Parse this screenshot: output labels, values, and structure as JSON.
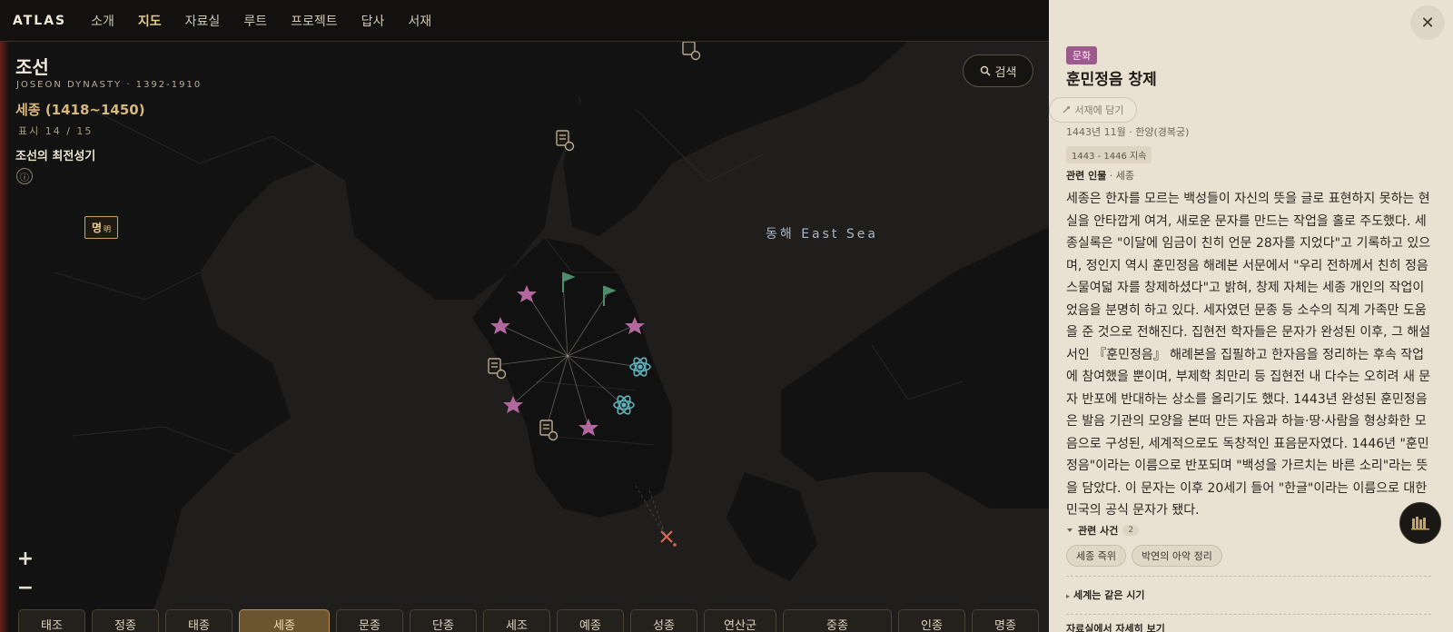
{
  "nav": {
    "brand": "ATLAS",
    "items": [
      "소개",
      "지도",
      "자료실",
      "루트",
      "프로젝트",
      "답사",
      "서재"
    ],
    "active_index": 1
  },
  "era": {
    "title": "조선",
    "subtitle": "JOSEON DYNASTY · 1392-1910",
    "reign": "세종 (1418~1450)",
    "count": "표시 14 / 15",
    "motto": "조선의 최전성기",
    "info_symbol": "ⓘ"
  },
  "map": {
    "ming_label": "명",
    "ming_hanja": "明",
    "sea_label": "동해 East Sea",
    "search_label": "검색",
    "zoom_in": "+",
    "zoom_out": "−"
  },
  "timeline": {
    "items": [
      "태조",
      "정종",
      "태종",
      "세종",
      "문종",
      "단종",
      "세조",
      "예종",
      "성종",
      "연산군",
      "중종",
      "인종",
      "명종"
    ],
    "active_index": 3
  },
  "panel": {
    "category": "문화",
    "title": "훈민정음 창제",
    "save_label": "서재에 담기",
    "date": "1443년 11월 · 한양(경복궁)",
    "duration": "1443 - 1446 지속",
    "related_person_label": "관련 인물",
    "related_person": " · 세종",
    "body": "세종은 한자를 모르는 백성들이 자신의 뜻을 글로 표현하지 못하는 현실을 안타깝게 여겨, 새로운 문자를 만드는 작업을 홀로 주도했다. 세종실록은 \"이달에 임금이 친히 언문 28자를 지었다\"고 기록하고 있으며, 정인지 역시 훈민정음 해례본 서문에서 \"우리 전하께서 친히 정음 스물여덟 자를 창제하셨다\"고 밝혀, 창제 자체는 세종 개인의 작업이었음을 분명히 하고 있다. 세자였던 문종 등 소수의 직계 가족만 도움을 준 것으로 전해진다. 집현전 학자들은 문자가 완성된 이후, 그 해설서인 『훈민정음』 해례본을 집필하고 한자음을 정리하는 후속 작업에 참여했을 뿐이며, 부제학 최만리 등 집현전 내 다수는 오히려 새 문자 반포에 반대하는 상소를 올리기도 했다. 1443년 완성된 훈민정음은 발음 기관의 모양을 본떠 만든 자음과 하늘·땅·사람을 형상화한 모음으로 구성된, 세계적으로도 독창적인 표음문자였다. 1446년 \"훈민정음\"이라는 이름으로 반포되며 \"백성을 가르치는 바른 소리\"라는 뜻을 담았다. 이 문자는 이후 20세기 들어 \"한글\"이라는 이름으로 대한민국의 공식 문자가 됐다.",
    "events_label": "관련 사건",
    "events_count": "2",
    "events": [
      "세종 즉위",
      "박연의 아악 정리"
    ],
    "world_label": "세계는 같은 시기",
    "archive_label": "자료실에서 자세히 보기",
    "close_symbol": "✕"
  },
  "colors": {
    "accent_gold": "#d7b77a",
    "culture_purple": "#9c5a8f",
    "star_pink": "#b2679e",
    "atom_teal": "#5fb4bd",
    "flag_green": "#4f8c6c",
    "panel_bg": "#e9e2d3"
  }
}
